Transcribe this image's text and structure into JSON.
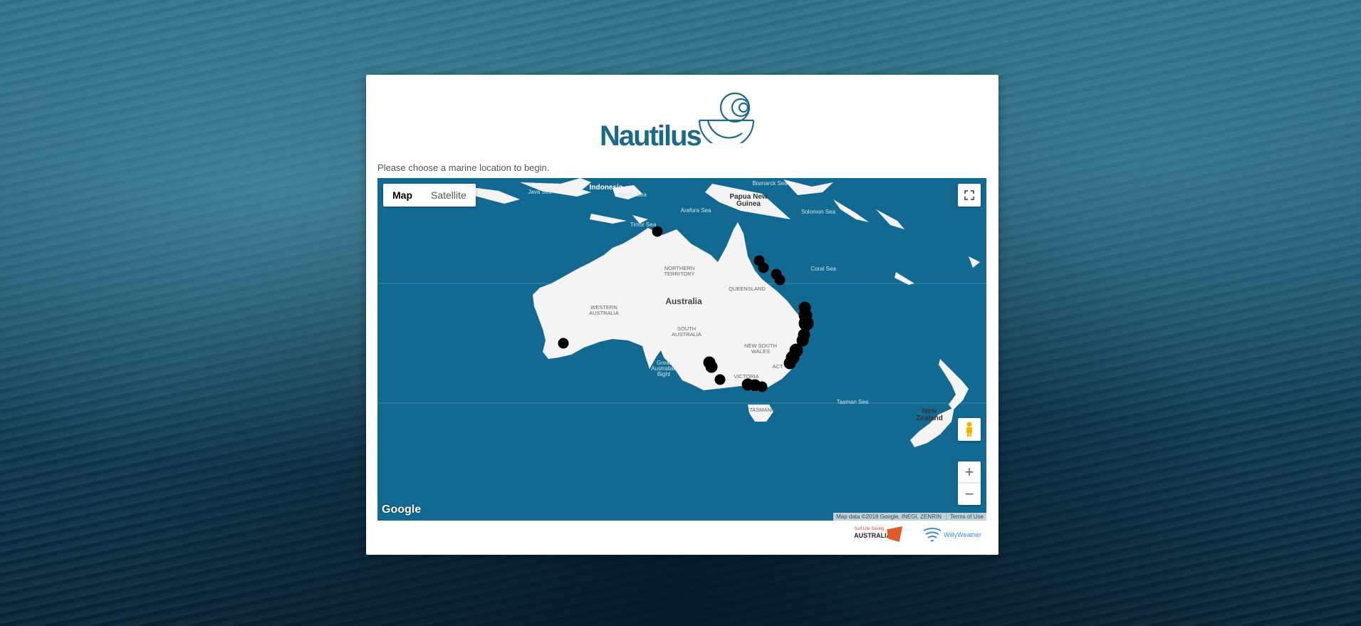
{
  "logo": {
    "text": "Nautilus"
  },
  "intro": {
    "text": "Please choose a marine location to begin."
  },
  "map": {
    "tabs": [
      "Map",
      "Satellite"
    ],
    "labels": {
      "indonesia": "Indonesia",
      "java_sea": "Java Sea",
      "banda_sea": "Banda Sea",
      "bismarck_sea": "Bismarck Sea",
      "png1": "Papua New",
      "png2": "Guinea",
      "arafura_sea": "Arafura Sea",
      "solomon_sea": "Solomon Sea",
      "timor_sea": "Timor Sea",
      "coral_sea": "Coral Sea",
      "nt1": "NORTHERN",
      "nt2": "TERRITORY",
      "qld": "QUEENSLAND",
      "australia": "Australia",
      "wa1": "WESTERN",
      "wa2": "AUSTRALIA",
      "sa1": "SOUTH",
      "sa2": "AUSTRALIA",
      "nsw1": "NEW SOUTH",
      "nsw2": "WALES",
      "act": "ACT",
      "gab1": "Great",
      "gab2": "Australian",
      "gab3": "Bight",
      "vic": "VICTORIA",
      "tas": "TASMANIA",
      "tasman_sea": "Tasman Sea",
      "nz1": "New",
      "nz2": "Zealand"
    },
    "google": "Google",
    "attribution": "Map data ©2018 Google, INEGI, ZENRIN",
    "terms": "Terms of Use",
    "zoom_in": "+",
    "zoom_out": "−"
  },
  "sponsors": {
    "sla_top": "Surf Life Saving",
    "sla_main": "AUSTRALIA",
    "willy": "WillyWeather"
  }
}
